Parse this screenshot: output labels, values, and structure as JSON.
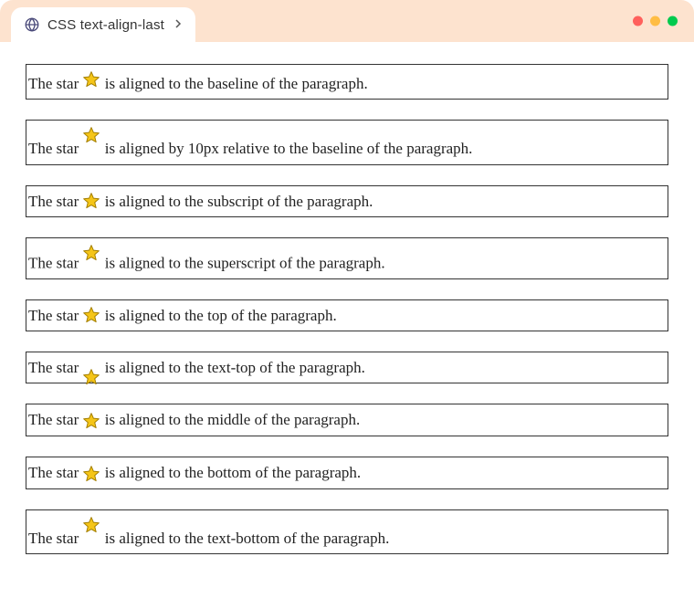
{
  "tab": {
    "title": "CSS text-align-last"
  },
  "examples": [
    {
      "prefix": "The star ",
      "suffix": " is aligned to the baseline of the paragraph.",
      "alignClass": "va-baseline"
    },
    {
      "prefix": "The star ",
      "suffix": " is aligned by 10px relative to the baseline of the paragraph.",
      "alignClass": "va-10px"
    },
    {
      "prefix": "The star ",
      "suffix": " is aligned to the subscript of the paragraph.",
      "alignClass": "va-sub"
    },
    {
      "prefix": "The star ",
      "suffix": " is aligned to the superscript of the paragraph.",
      "alignClass": "va-super"
    },
    {
      "prefix": "The star ",
      "suffix": " is aligned to the top of the paragraph.",
      "alignClass": "va-top"
    },
    {
      "prefix": "The star ",
      "suffix": " is aligned to the text-top of the paragraph.",
      "alignClass": "va-text-top"
    },
    {
      "prefix": "The star ",
      "suffix": " is aligned to the middle of the paragraph.",
      "alignClass": "va-middle"
    },
    {
      "prefix": "The star ",
      "suffix": " is aligned to the bottom of the paragraph.",
      "alignClass": "va-bottom"
    },
    {
      "prefix": "The star ",
      "suffix": " is aligned to the text-bottom of the paragraph.",
      "alignClass": "va-text-bottom"
    }
  ],
  "icons": {
    "star_color": "#f5c518",
    "star_stroke": "#a47f00"
  }
}
